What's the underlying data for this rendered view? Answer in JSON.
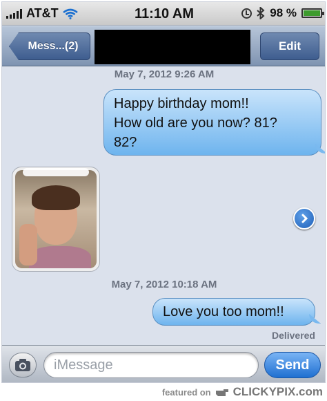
{
  "status_bar": {
    "carrier": "AT&T",
    "time": "11:10 AM",
    "battery": "98 %",
    "battery_level": 0.98
  },
  "nav": {
    "back_label": "Mess...(2)",
    "edit_label": "Edit"
  },
  "messages": [
    {
      "timestamp": "May 7, 2012 9:26 AM",
      "lines": [
        "Happy birthday mom!!",
        "How old are you now? 81?",
        "82?"
      ]
    },
    {
      "timestamp": "May 7, 2012 10:18 AM",
      "lines": [
        "Love you too mom!!"
      ],
      "status": "Delivered"
    }
  ],
  "input_bar": {
    "placeholder": "iMessage",
    "send_label": "Send"
  },
  "watermark": {
    "featured": "featured on",
    "brand": "CLICKYPIX.com"
  }
}
